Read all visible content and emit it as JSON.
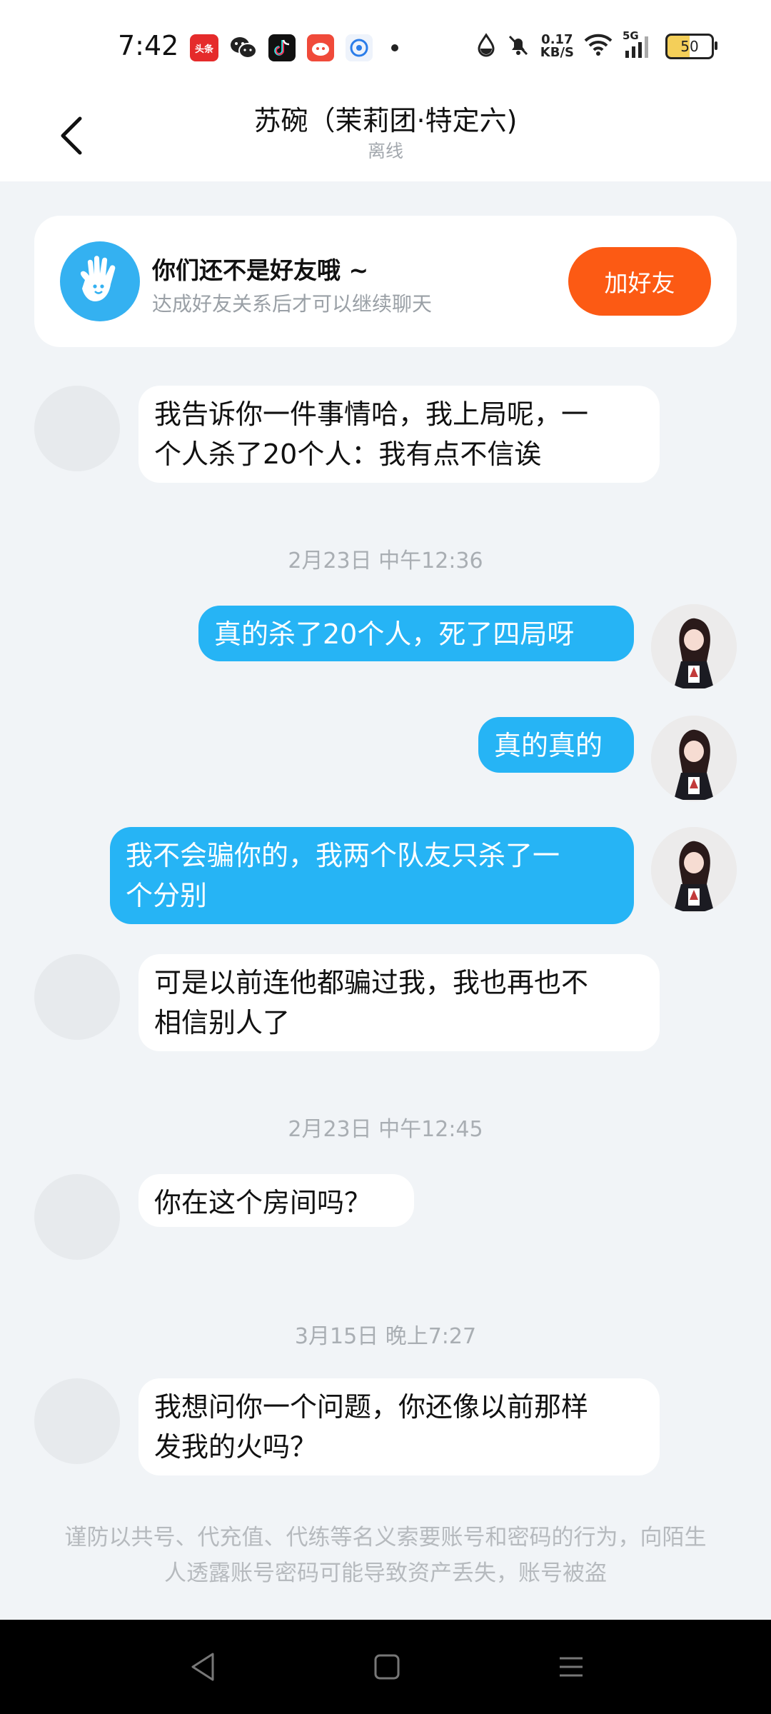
{
  "status_bar": {
    "time": "7:42",
    "apps": [
      "toutiao-icon",
      "wechat-icon",
      "douyin-icon",
      "red-app-icon",
      "qq-browser-icon"
    ],
    "toutiao_label": "头条",
    "net_speed_value": "0.17",
    "net_speed_unit": "KB/S",
    "signal_label": "5G",
    "battery": "50"
  },
  "header": {
    "title": "苏碗（茉莉团·特定六)",
    "subtitle": "离线"
  },
  "friend_card": {
    "title": "你们还不是好友哦 ~",
    "subtitle": "达成好友关系后才可以继续聊天",
    "button": "加好友"
  },
  "messages": [
    {
      "side": "in",
      "text_line1": "我告诉你一件事情哈，我上局呢，一",
      "text_line2": "个人杀了20个人：我有点不信诶"
    },
    {
      "timestamp": "2月23日 中午12:36"
    },
    {
      "side": "out",
      "text": "真的杀了20个人，死了四局呀"
    },
    {
      "side": "out",
      "text": "真的真的"
    },
    {
      "side": "out",
      "text_line1": "我不会骗你的，我两个队友只杀了一",
      "text_line2": "个分别"
    },
    {
      "side": "in",
      "text_line1": "可是以前连他都骗过我，我也再也不",
      "text_line2": "相信别人了"
    },
    {
      "timestamp": "2月23日 中午12:45"
    },
    {
      "side": "in",
      "text": "你在这个房间吗？"
    },
    {
      "timestamp": "3月15日 晚上7:27"
    },
    {
      "side": "in",
      "text_line1": "我想问你一个问题，你还像以前那样",
      "text_line2": "发我的火吗？"
    }
  ],
  "notice": "谨防以共号、代充值、代练等名义索要账号和密码的行为，向陌生人透露账号密码可能导致资产丢失，账号被盗",
  "colors": {
    "accent_blue": "#26b4f5",
    "add_friend_orange": "#fc5a14",
    "background": "#f1f4f7"
  }
}
